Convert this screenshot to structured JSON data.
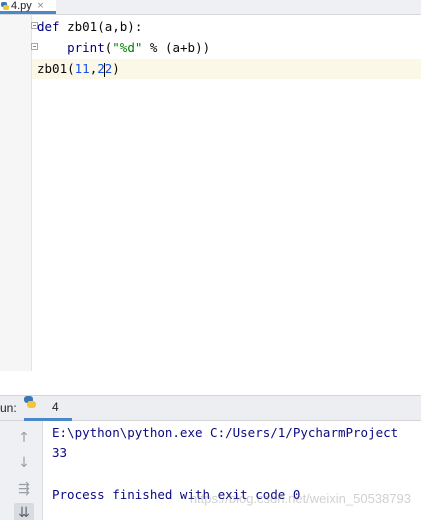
{
  "editor_tab": {
    "filename": "4.py",
    "close_glyph": "×"
  },
  "code": {
    "line1": {
      "kw": "def",
      "rest": " zb01(a,b):"
    },
    "line2": {
      "indent": "    ",
      "fn": "print",
      "open": "(",
      "str": "\"%d\"",
      "mid": " % (a+b))"
    },
    "line3": {
      "fn": "zb01(",
      "num1": "11",
      "comma": ",",
      "num2a": "2",
      "num2b": "2",
      "close": ")"
    }
  },
  "run_panel": {
    "label": "un:",
    "tab_label": "4",
    "toolbar": {
      "up_glyph": "↑",
      "down_glyph": "↓",
      "wrap_glyph": "⇶",
      "sort_glyph": "⇊"
    },
    "output": {
      "command": "E:\\python\\python.exe C:/Users/1/PycharmProject",
      "result": "33",
      "exit_message": "Process finished with exit code 0"
    }
  },
  "watermark": "https://blog.csdn.net/weixin_50538793",
  "colors": {
    "keyword": "#000080",
    "string": "#008000",
    "number": "#1750eb",
    "caret_row": "#fbf8e7",
    "accent": "#4a88c7"
  }
}
